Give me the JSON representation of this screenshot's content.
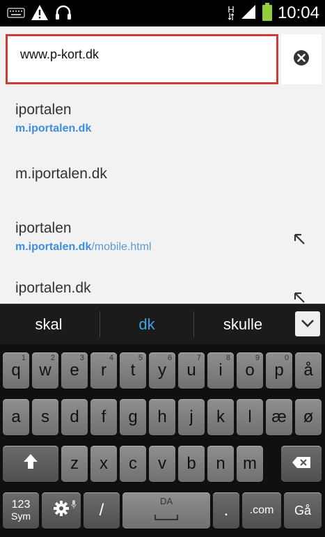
{
  "status_bar": {
    "time": "10:04",
    "network_type": "H",
    "icons": [
      "keyboard-icon",
      "warning-icon",
      "headset-icon",
      "data-transfer-icon",
      "signal-icon",
      "battery-icon"
    ],
    "battery_color": "#8fd13a"
  },
  "url_bar": {
    "value": "www.p-kort.dk",
    "highlight_color": "#cc3a3a",
    "clear_icon": "clear-icon"
  },
  "suggestions": [
    {
      "title": "iportalen",
      "url_bold": "m.iportalen.dk",
      "url_rest": "",
      "has_arrow": false
    },
    {
      "title": "m.iportalen.dk",
      "url_bold": "",
      "url_rest": "",
      "has_arrow": false
    },
    {
      "title": "iportalen",
      "url_bold": "m.iportalen.dk",
      "url_rest": "/mobile.html",
      "has_arrow": true
    },
    {
      "title": "iportalen.dk",
      "url_bold": "",
      "url_rest": "",
      "has_arrow": true
    }
  ],
  "predictions": {
    "items": [
      "skal",
      "dk",
      "skulle"
    ],
    "selected_index": 1,
    "accent_color": "#3fa3e8"
  },
  "keyboard": {
    "row1": [
      {
        "l": "q",
        "n": "1"
      },
      {
        "l": "w",
        "n": "2"
      },
      {
        "l": "e",
        "n": "3"
      },
      {
        "l": "r",
        "n": "4"
      },
      {
        "l": "t",
        "n": "5"
      },
      {
        "l": "y",
        "n": "6"
      },
      {
        "l": "u",
        "n": "7"
      },
      {
        "l": "i",
        "n": "8"
      },
      {
        "l": "o",
        "n": "9"
      },
      {
        "l": "p",
        "n": "0"
      },
      {
        "l": "å",
        "n": ""
      }
    ],
    "row2": [
      "a",
      "s",
      "d",
      "f",
      "g",
      "h",
      "j",
      "k",
      "l",
      "æ",
      "ø"
    ],
    "row3": [
      "z",
      "x",
      "c",
      "v",
      "b",
      "n",
      "m"
    ],
    "sym_label_top": "123",
    "sym_label_bottom": "Sym",
    "slash": "/",
    "space_label": "DA",
    "period": ".",
    "com": ".com",
    "go": "Gå"
  }
}
